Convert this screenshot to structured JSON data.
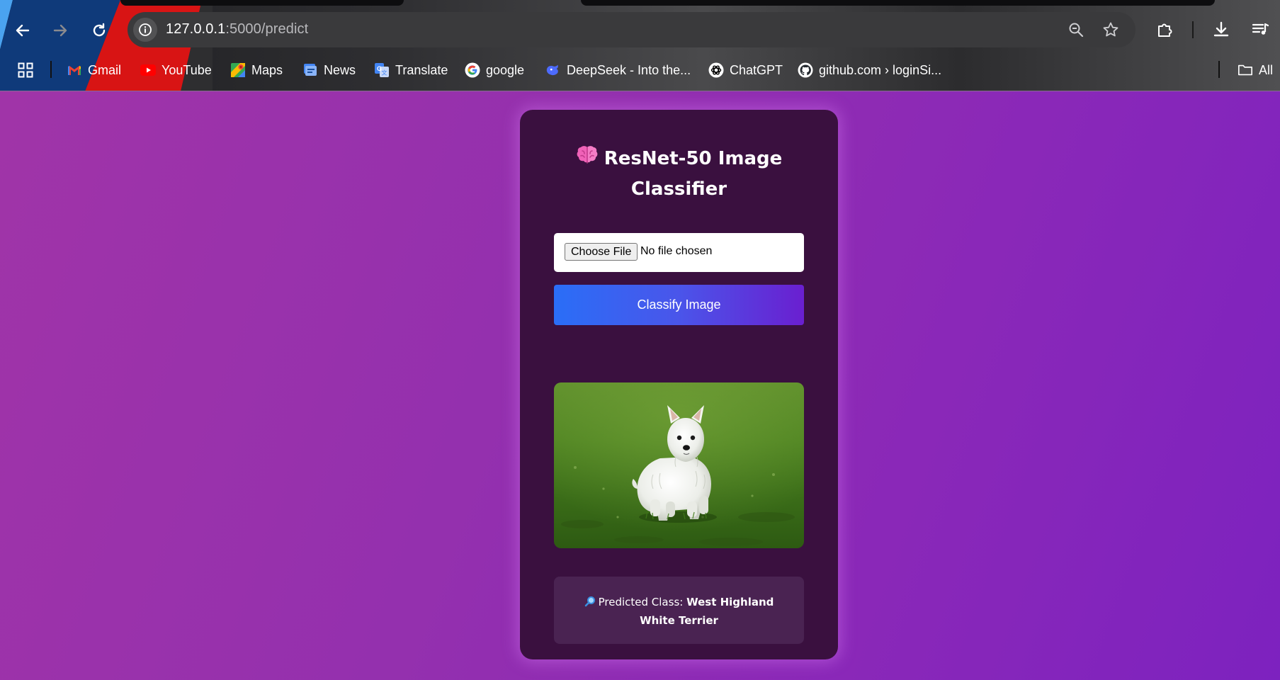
{
  "browser": {
    "url_host": "127.0.0.1",
    "url_path": ":5000/predict",
    "bookmarks": [
      {
        "label": "Gmail",
        "icon": "gmail-icon"
      },
      {
        "label": "YouTube",
        "icon": "youtube-icon"
      },
      {
        "label": "Maps",
        "icon": "maps-icon"
      },
      {
        "label": "News",
        "icon": "news-icon"
      },
      {
        "label": "Translate",
        "icon": "translate-icon"
      },
      {
        "label": "google",
        "icon": "google-icon"
      },
      {
        "label": "DeepSeek - Into the...",
        "icon": "deepseek-icon"
      },
      {
        "label": "ChatGPT",
        "icon": "chatgpt-icon"
      },
      {
        "label": "github.com › loginSi...",
        "icon": "github-icon"
      }
    ],
    "all_bookmarks_label": "All"
  },
  "app": {
    "title": "ResNet-50 Image Classifier",
    "file_input": {
      "button_label": "Choose File",
      "status": "No file chosen"
    },
    "classify_button": "Classify Image",
    "result": {
      "prefix": "Predicted Class:",
      "value": "West Highland White Terrier"
    }
  },
  "colors": {
    "page_gradient_start": "#a034a8",
    "page_gradient_end": "#7d22bf",
    "card_background": "#3a103f",
    "button_gradient_start": "#2a6ef7",
    "button_gradient_end": "#6a1fd0",
    "result_background": "#4a2352"
  }
}
